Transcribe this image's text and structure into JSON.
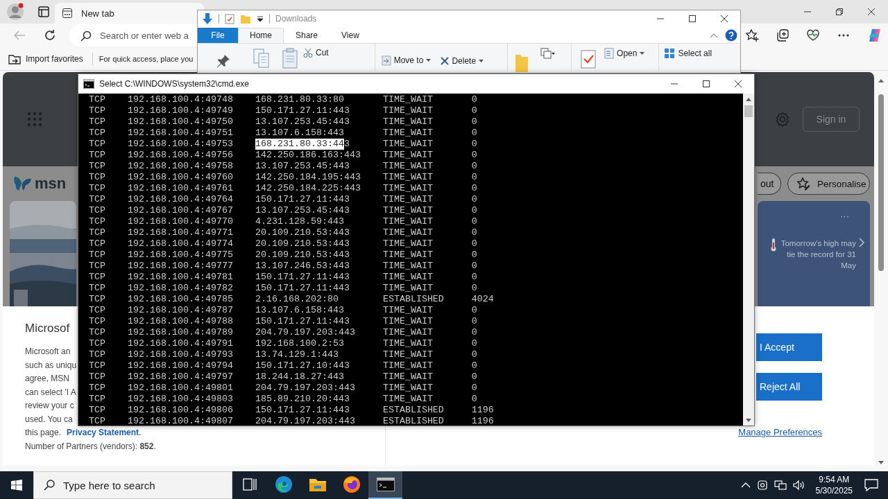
{
  "browser": {
    "tabs": [
      {
        "label": "New tab",
        "selected": true
      }
    ],
    "address": {
      "placeholder": "Search or enter web a"
    },
    "favorites": [
      "Import favorites",
      "For quick access, place you"
    ],
    "msn": {
      "sign_in": "Sign in",
      "logo": "msn",
      "pills": [
        "out",
        "Personalise"
      ],
      "weather": {
        "more": "···",
        "text": "Tomorrow's high may tie the record for 31 May"
      },
      "consent": {
        "title": "Microsof",
        "lines": [
          "Microsoft an",
          "such as uniqu",
          "agree, MSN",
          "can select 'I A",
          "review your c",
          "used. You ca"
        ],
        "privacy_before": "this page.",
        "privacy_link": "Privacy Statement",
        "privacy_after": ".",
        "partners": "Number of Partners (vendors): **852**.",
        "accept": "I Accept",
        "reject": "Reject All",
        "manage": "Manage Preferences"
      }
    }
  },
  "explorer": {
    "title": "Downloads",
    "tabs": [
      {
        "label": "File",
        "kind": "file",
        "selected": false
      },
      {
        "label": "Home",
        "kind": "tab",
        "selected": true
      },
      {
        "label": "Share",
        "kind": "tab",
        "selected": false
      },
      {
        "label": "View",
        "kind": "tab",
        "selected": false
      }
    ],
    "commands": [
      {
        "label": "Cut",
        "dropdown": false
      },
      {
        "label": "Move to",
        "dropdown": true
      },
      {
        "label": "Delete",
        "dropdown": true
      },
      {
        "label": "Open",
        "dropdown": true
      },
      {
        "label": "Select all",
        "dropdown": false
      }
    ]
  },
  "cmd": {
    "title": "Select C:\\WINDOWS\\system32\\cmd.exe",
    "rows": [
      {
        "cells": [
          "TCP",
          "192.168.100.4:49748",
          "168.231.80.33:80",
          "TIME_WAIT",
          "0"
        ]
      },
      {
        "cells": [
          "TCP",
          "192.168.100.4:49749",
          "150.171.27.11:443",
          "TIME_WAIT",
          "0"
        ]
      },
      {
        "cells": [
          "TCP",
          "192.168.100.4:49750",
          "13.107.253.45:443",
          "TIME_WAIT",
          "0"
        ]
      },
      {
        "cells": [
          "TCP",
          "192.168.100.4:49751",
          "13.107.6.158:443",
          "TIME_WAIT",
          "0"
        ]
      },
      {
        "cells": [
          "TCP",
          "192.168.100.4:49753",
          "168.231.80.33:443",
          "TIME_WAIT",
          "0"
        ],
        "selection": {
          "level": 0.941
        }
      },
      {
        "cells": [
          "TCP",
          "192.168.100.4:49756",
          "142.250.186.163:443",
          "TIME_WAIT",
          "0"
        ]
      },
      {
        "cells": [
          "TCP",
          "192.168.100.4:49758",
          "13.107.253.45:443",
          "TIME_WAIT",
          "0"
        ]
      },
      {
        "cells": [
          "TCP",
          "192.168.100.4:49760",
          "142.250.184.195:443",
          "TIME_WAIT",
          "0"
        ]
      },
      {
        "cells": [
          "TCP",
          "192.168.100.4:49761",
          "142.250.184.225:443",
          "TIME_WAIT",
          "0"
        ]
      },
      {
        "cells": [
          "TCP",
          "192.168.100.4:49764",
          "150.171.27.11:443",
          "TIME_WAIT",
          "0"
        ]
      },
      {
        "cells": [
          "TCP",
          "192.168.100.4:49767",
          "13.107.253.45:443",
          "TIME_WAIT",
          "0"
        ]
      },
      {
        "cells": [
          "TCP",
          "192.168.100.4:49770",
          "4.231.128.59:443",
          "TIME_WAIT",
          "0"
        ]
      },
      {
        "cells": [
          "TCP",
          "192.168.100.4:49771",
          "20.109.210.53:443",
          "TIME_WAIT",
          "0"
        ]
      },
      {
        "cells": [
          "TCP",
          "192.168.100.4:49774",
          "20.109.210.53:443",
          "TIME_WAIT",
          "0"
        ]
      },
      {
        "cells": [
          "TCP",
          "192.168.100.4:49775",
          "20.109.210.53:443",
          "TIME_WAIT",
          "0"
        ]
      },
      {
        "cells": [
          "TCP",
          "192.168.100.4:49777",
          "13.107.246.53:443",
          "TIME_WAIT",
          "0"
        ]
      },
      {
        "cells": [
          "TCP",
          "192.168.100.4:49781",
          "150.171.27.11:443",
          "TIME_WAIT",
          "0"
        ]
      },
      {
        "cells": [
          "TCP",
          "192.168.100.4:49782",
          "150.171.27.11:443",
          "TIME_WAIT",
          "0"
        ]
      },
      {
        "cells": [
          "TCP",
          "192.168.100.4:49785",
          "2.16.168.202:80",
          "ESTABLISHED",
          "4024"
        ]
      },
      {
        "cells": [
          "TCP",
          "192.168.100.4:49787",
          "13.107.6.158:443",
          "TIME_WAIT",
          "0"
        ]
      },
      {
        "cells": [
          "TCP",
          "192.168.100.4:49788",
          "150.171.27.11:443",
          "TIME_WAIT",
          "0"
        ]
      },
      {
        "cells": [
          "TCP",
          "192.168.100.4:49789",
          "204.79.197.203:443",
          "TIME_WAIT",
          "0"
        ]
      },
      {
        "cells": [
          "TCP",
          "192.168.100.4:49791",
          "192.168.100.2:53",
          "TIME_WAIT",
          "0"
        ]
      },
      {
        "cells": [
          "TCP",
          "192.168.100.4:49793",
          "13.74.129.1:443",
          "TIME_WAIT",
          "0"
        ]
      },
      {
        "cells": [
          "TCP",
          "192.168.100.4:49794",
          "150.171.27.10:443",
          "TIME_WAIT",
          "0"
        ]
      },
      {
        "cells": [
          "TCP",
          "192.168.100.4:49797",
          "18.244.18.27:443",
          "TIME_WAIT",
          "0"
        ]
      },
      {
        "cells": [
          "TCP",
          "192.168.100.4:49801",
          "204.79.197.203:443",
          "TIME_WAIT",
          "0"
        ]
      },
      {
        "cells": [
          "TCP",
          "192.168.100.4:49803",
          "185.89.210.20:443",
          "TIME_WAIT",
          "0"
        ]
      },
      {
        "cells": [
          "TCP",
          "192.168.100.4:49806",
          "150.171.27.11:443",
          "ESTABLISHED",
          "1196"
        ]
      },
      {
        "cells": [
          "TCP",
          "192.168.100.4:49807",
          "204.79.197.203:443",
          "ESTABLISHED",
          "1196"
        ]
      }
    ]
  },
  "taskbar": {
    "search_placeholder": "Type here to search",
    "apps": [
      {
        "kind": "task-view",
        "selected": false
      },
      {
        "kind": "edge",
        "selected": false
      },
      {
        "kind": "folder",
        "selected": false
      },
      {
        "kind": "firefox",
        "selected": false
      },
      {
        "kind": "terminal",
        "selected": true
      }
    ],
    "time": "9:54 AM",
    "date": "5/30/2025"
  }
}
